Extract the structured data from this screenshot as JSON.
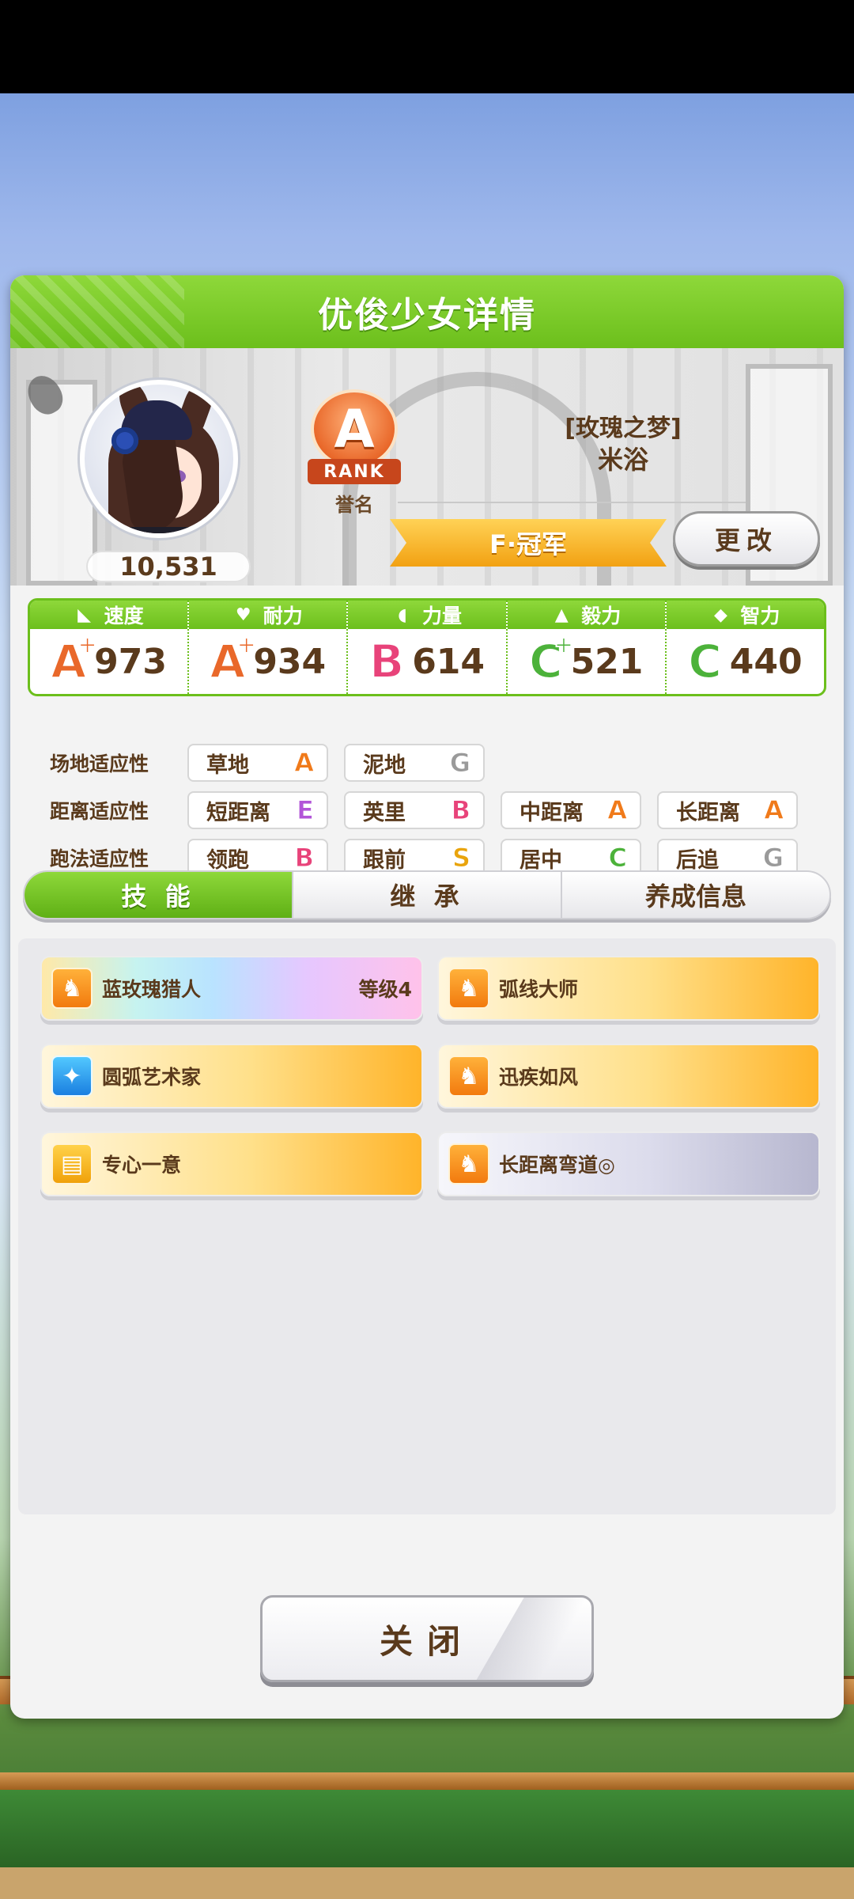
{
  "panel": {
    "title": "优俊少女详情"
  },
  "profile": {
    "fans": "10,531",
    "rank_grade": "A",
    "rank_ribbon": "RANK",
    "rank_label": "誉名",
    "epithet": "[玫瑰之梦]",
    "name": "米浴",
    "title": "F·冠军",
    "change_label": "更改"
  },
  "stats": [
    {
      "label": "速度",
      "icon": "speed-shoe-icon",
      "grade": "A",
      "plus": "+",
      "value": "973",
      "color": "#e9682a"
    },
    {
      "label": "耐力",
      "icon": "heart-icon",
      "grade": "A",
      "plus": "+",
      "value": "934",
      "color": "#e9682a"
    },
    {
      "label": "力量",
      "icon": "muscle-icon",
      "grade": "B",
      "plus": "",
      "value": "614",
      "color": "#e8437a"
    },
    {
      "label": "毅力",
      "icon": "flame-icon",
      "grade": "C",
      "plus": "+",
      "value": "521",
      "color": "#4cb23a"
    },
    {
      "label": "智力",
      "icon": "graduation-cap-icon",
      "grade": "C",
      "plus": "",
      "value": "440",
      "color": "#4cb23a"
    }
  ],
  "aptitudes": {
    "track": {
      "label": "场地适应性",
      "items": [
        {
          "name": "草地",
          "grade": "A",
          "color": "#f07a1a"
        },
        {
          "name": "泥地",
          "grade": "G",
          "color": "#9a9a9a"
        }
      ]
    },
    "distance": {
      "label": "距离适应性",
      "items": [
        {
          "name": "短距离",
          "grade": "E",
          "color": "#b254d8"
        },
        {
          "name": "英里",
          "grade": "B",
          "color": "#e8437a"
        },
        {
          "name": "中距离",
          "grade": "A",
          "color": "#f07a1a"
        },
        {
          "name": "长距离",
          "grade": "A",
          "color": "#f07a1a"
        }
      ]
    },
    "strategy": {
      "label": "跑法适应性",
      "items": [
        {
          "name": "领跑",
          "grade": "B",
          "color": "#e8437a"
        },
        {
          "name": "跟前",
          "grade": "S",
          "color": "#e9a40c"
        },
        {
          "name": "居中",
          "grade": "C",
          "color": "#4cb23a"
        },
        {
          "name": "后追",
          "grade": "G",
          "color": "#9a9a9a"
        }
      ]
    }
  },
  "tabs": [
    {
      "label": "技 能",
      "active": true
    },
    {
      "label": "继 承",
      "active": false
    },
    {
      "label": "养成信息",
      "active": false
    }
  ],
  "skills": [
    {
      "name": "蓝玫瑰猎人",
      "level": "等级4",
      "style": "rainbow",
      "icon": "speed-horse-icon"
    },
    {
      "name": "弧线大师",
      "level": "",
      "style": "gold",
      "icon": "speed-horse-icon"
    },
    {
      "name": "圆弧艺术家",
      "level": "",
      "style": "gold",
      "icon": "sparkle-icon"
    },
    {
      "name": "迅疾如风",
      "level": "",
      "style": "gold",
      "icon": "speed-horse-icon"
    },
    {
      "name": "专心一意",
      "level": "",
      "style": "gold",
      "icon": "gate-icon"
    },
    {
      "name": "长距离弯道◎",
      "level": "",
      "style": "silver",
      "icon": "speed-horse-icon"
    }
  ],
  "footer": {
    "close_label": "关闭"
  }
}
